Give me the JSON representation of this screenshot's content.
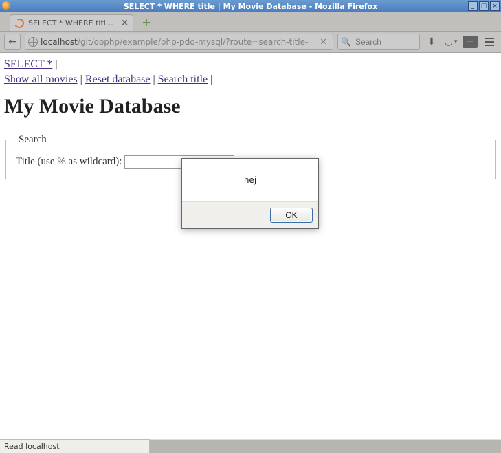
{
  "window": {
    "title": "SELECT * WHERE title | My Movie Database - Mozilla Firefox"
  },
  "tab": {
    "title": "SELECT * WHERE title | M…"
  },
  "url": {
    "host": "localhost",
    "path": "/git/oophp/example/php-pdo-mysql/?route=search-title-"
  },
  "search": {
    "placeholder": "Search"
  },
  "nav": {
    "link_select": "SELECT *",
    "link_show_all": "Show all movies",
    "link_reset": "Reset database",
    "link_search_title": "Search title",
    "sep": " | "
  },
  "heading": "My Movie Database",
  "form": {
    "legend": "Search",
    "title_label": "Title (use % as wildcard): ",
    "title_value": ""
  },
  "dialog": {
    "message": "hej",
    "ok": "OK"
  },
  "status": "Read localhost"
}
